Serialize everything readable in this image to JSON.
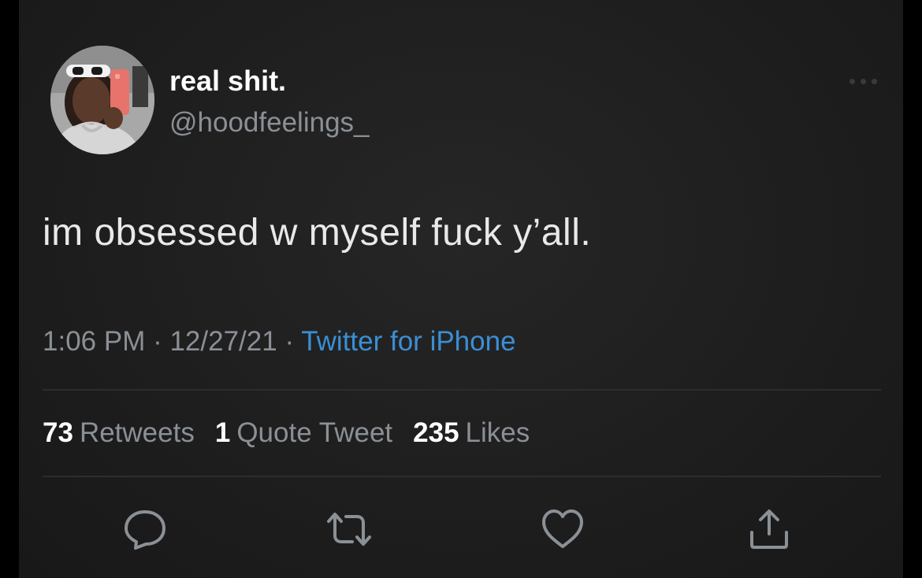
{
  "user": {
    "display_name": "real shit.",
    "handle": "@hoodfeelings_"
  },
  "tweet": {
    "text": "im obsessed w myself fuck y’all."
  },
  "meta": {
    "time": "1:06 PM",
    "date": "12/27/21",
    "source": "Twitter for iPhone",
    "separator": " · "
  },
  "stats": {
    "retweets_count": "73",
    "retweets_label": "Retweets",
    "quotes_count": "1",
    "quotes_label": "Quote Tweet",
    "likes_count": "235",
    "likes_label": "Likes"
  },
  "actions": {
    "reply_icon": "reply-icon",
    "retweet_icon": "retweet-icon",
    "like_icon": "heart-icon",
    "share_icon": "share-icon"
  },
  "colors": {
    "background": "#1e1e1e",
    "text": "#e9e9e9",
    "secondary_text": "#8b9096",
    "link": "#3a8fd6",
    "icon": "#8b9096"
  }
}
